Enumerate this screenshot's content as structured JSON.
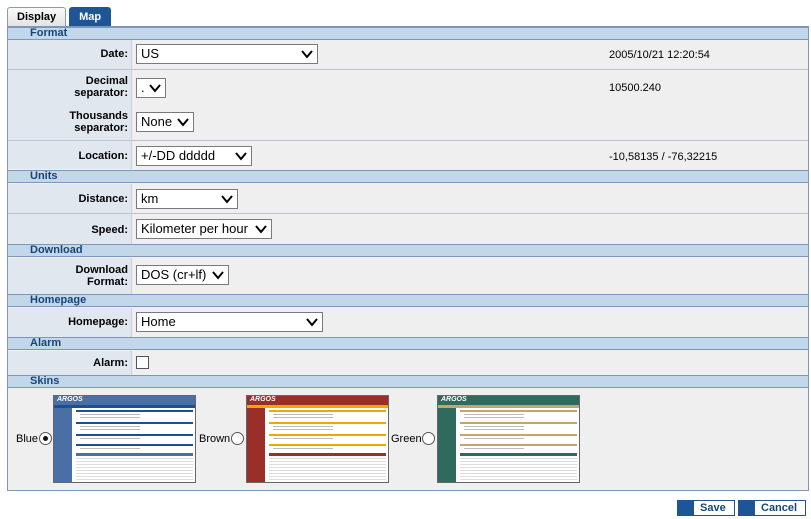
{
  "tabs": [
    {
      "label": "Display",
      "active": false
    },
    {
      "label": "Map",
      "active": true
    }
  ],
  "sections": {
    "format": "Format",
    "units": "Units",
    "download": "Download",
    "homepage": "Homepage",
    "alarm": "Alarm",
    "skins": "Skins"
  },
  "format": {
    "date_label": "Date:",
    "date_value": "US",
    "date_preview": "2005/10/21 12:20:54",
    "decimal_label_1": "Decimal",
    "decimal_label_2": "separator:",
    "decimal_value": ".",
    "thousands_label_1": "Thousands",
    "thousands_label_2": "separator:",
    "thousands_value": "None",
    "number_preview": "10500.240",
    "location_label": "Location:",
    "location_value": "+/-DD ddddd",
    "location_preview": "-10,58135 / -76,32215"
  },
  "units": {
    "distance_label": "Distance:",
    "distance_value": "km",
    "speed_label": "Speed:",
    "speed_value": "Kilometer per hour"
  },
  "download": {
    "format_label_1": "Download",
    "format_label_2": "Format:",
    "format_value": "DOS (cr+lf)"
  },
  "homepage": {
    "label": "Homepage:",
    "value": "Home"
  },
  "alarm": {
    "label": "Alarm:",
    "checked": false
  },
  "skins": {
    "items": [
      {
        "label": "Blue",
        "selected": true,
        "color": "#4a6fa5",
        "accent": "#1e4f8f",
        "thumb_logo": "ARGOS"
      },
      {
        "label": "Brown",
        "selected": false,
        "color": "#9a2f2a",
        "accent": "#f0a800",
        "thumb_logo": "ARGOS"
      },
      {
        "label": "Green",
        "selected": false,
        "color": "#2e6b5e",
        "accent": "#c9a46a",
        "thumb_logo": "ARGOS"
      }
    ]
  },
  "buttons": {
    "save": "Save",
    "cancel": "Cancel"
  },
  "colors": {
    "brand": "#1e5594",
    "section_bg": "#c3d7ea",
    "label_bg": "#e0e7ef"
  }
}
